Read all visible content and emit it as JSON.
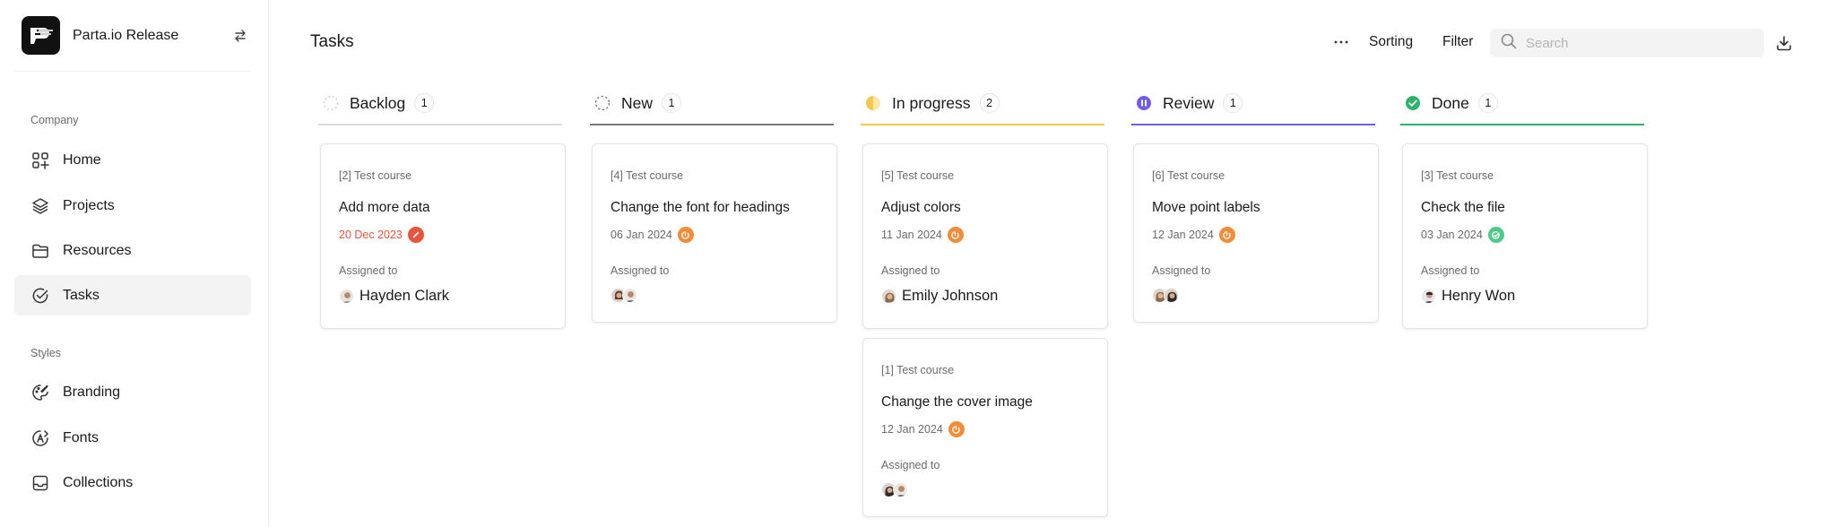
{
  "sidebar": {
    "workspace_name": "Parta.io Release",
    "sections": [
      {
        "label": "Company",
        "items": [
          {
            "label": "Home",
            "icon": "grid-plus-icon"
          },
          {
            "label": "Projects",
            "icon": "layers-icon"
          },
          {
            "label": "Resources",
            "icon": "folder-icon"
          },
          {
            "label": "Tasks",
            "icon": "check-circle-icon",
            "active": true
          }
        ]
      },
      {
        "label": "Styles",
        "items": [
          {
            "label": "Branding",
            "icon": "palette-icon"
          },
          {
            "label": "Fonts",
            "icon": "font-icon"
          },
          {
            "label": "Collections",
            "icon": "inbox-icon"
          }
        ]
      }
    ]
  },
  "header": {
    "title": "Tasks",
    "sorting_label": "Sorting",
    "filter_label": "Filter",
    "search_placeholder": "Search"
  },
  "colors": {
    "backlog": "#cfcfcf",
    "new": "#7a7a7a",
    "in_progress": "#f2c94c",
    "review": "#6f5ee8",
    "done": "#2fb36b",
    "overdue": "#e8553b",
    "pending_badge": "#f28c38",
    "done_badge": "#4fc98a"
  },
  "columns": [
    {
      "title": "Backlog",
      "count": "1",
      "cards": [
        {
          "course": "[2] Test course",
          "title": "Add more data",
          "date": "20 Dec 2023",
          "assigned_label": "Assigned to",
          "assignee": "Hayden Clark"
        }
      ]
    },
    {
      "title": "New",
      "count": "1",
      "cards": [
        {
          "course": "[4] Test course",
          "title": "Change the font for headings",
          "date": "06 Jan 2024",
          "assigned_label": "Assigned to",
          "assignee": ""
        }
      ]
    },
    {
      "title": "In progress",
      "count": "2",
      "cards": [
        {
          "course": "[5] Test course",
          "title": "Adjust colors",
          "date": "11 Jan 2024",
          "assigned_label": "Assigned to",
          "assignee": "Emily Johnson"
        },
        {
          "course": "[1] Test course",
          "title": "Change the cover image",
          "date": "12 Jan 2024",
          "assigned_label": "Assigned to",
          "assignee": ""
        }
      ]
    },
    {
      "title": "Review",
      "count": "1",
      "cards": [
        {
          "course": "[6] Test course",
          "title": "Move point labels",
          "date": "12 Jan 2024",
          "assigned_label": "Assigned to",
          "assignee": ""
        }
      ]
    },
    {
      "title": "Done",
      "count": "1",
      "cards": [
        {
          "course": "[3] Test course",
          "title": "Check the file",
          "date": "03 Jan 2024",
          "assigned_label": "Assigned to",
          "assignee": "Henry Won"
        }
      ]
    }
  ]
}
